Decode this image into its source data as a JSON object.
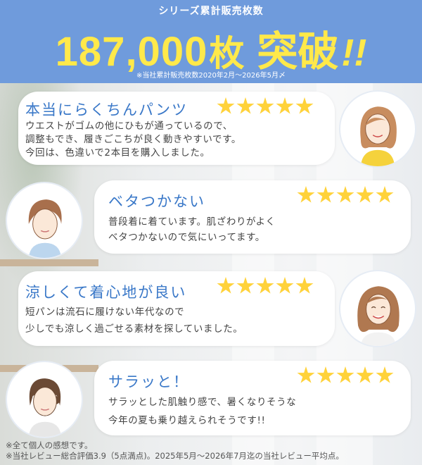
{
  "header": {
    "kicker": "シリーズ累計販売枚数",
    "count": "187,000",
    "unit": "枚",
    "headline": "突破",
    "exclaim": "!!",
    "note": "※当社累計販売枚数2020年2月〜2026年5月〆"
  },
  "reviews": [
    {
      "title": "本当にらくちんパンツ",
      "rating": 5,
      "lines": [
        "ウエストがゴムの他にひもが通っているので、",
        "調整もでき、履きごこちが良く動きやすいです。",
        "今回は、色違いで2本目を購入しました。"
      ]
    },
    {
      "title": "ベタつかない",
      "rating": 5,
      "lines": [
        "普段着に着ています。肌ざわりがよく",
        "ベタつかないので気にいってます。"
      ]
    },
    {
      "title": "涼しくて着心地が良い",
      "rating": 5,
      "lines": [
        "短パンは流石に履けない年代なので",
        "少しでも涼しく過ごせる素材を探していました。"
      ]
    },
    {
      "title": "サラッと！",
      "rating": 5,
      "lines": [
        "サラッとした肌触り感で、暑くなりそうな",
        "今年の夏も乗り越えられそうです!!"
      ]
    }
  ],
  "footer": {
    "note1": "※全て個人の感想です。",
    "note2": "※当社レビュー総合評価3.9（5点満点)。2025年5月〜2026年7月迄の当社レビュー平均点。"
  },
  "colors": {
    "banner": "#6f9bdc",
    "headline": "#ffe94a",
    "title": "#3a78c8",
    "star": "#ffd23a"
  }
}
